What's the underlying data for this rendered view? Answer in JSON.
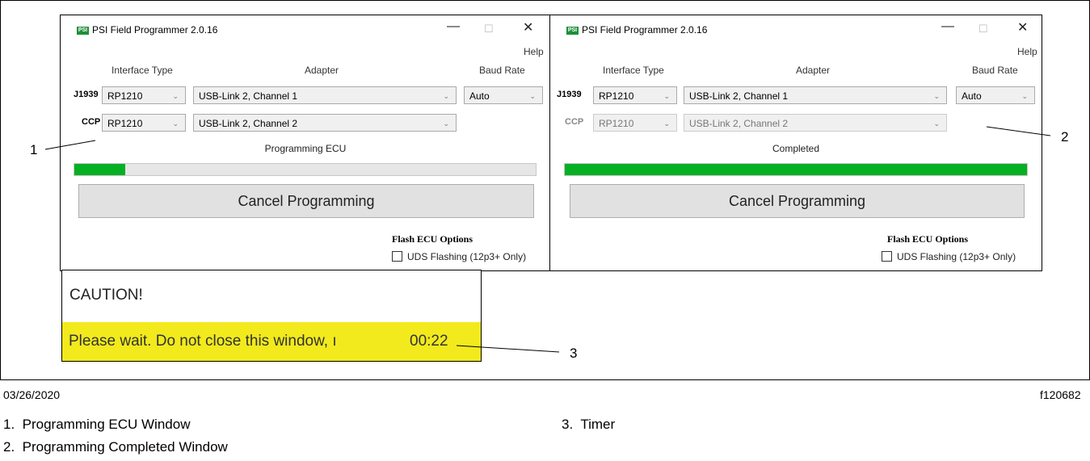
{
  "window": {
    "title": "PSI Field Programmer 2.0.16",
    "app_icon_text": "PSI",
    "minimize_glyph": "—",
    "maximize_glyph": "☐",
    "close_glyph": "✕",
    "help": "Help",
    "col_interface": "Interface Type",
    "col_adapter": "Adapter",
    "col_baud": "Baud Rate",
    "row_j1939": "J1939",
    "row_ccp": "CCP",
    "cancel_button": "Cancel Programming",
    "flash_header": "Flash ECU Options",
    "uds_checkbox": "UDS Flashing (12p3+ Only)"
  },
  "left_window": {
    "j1939_interface": "RP1210",
    "j1939_adapter": "USB-Link 2, Channel 1",
    "j1939_baud": "Auto",
    "ccp_interface": "RP1210",
    "ccp_adapter": "USB-Link 2, Channel 2",
    "status": "Programming ECU",
    "progress_fraction": 0.11
  },
  "right_window": {
    "j1939_interface": "RP1210",
    "j1939_adapter": "USB-Link 2, Channel 1",
    "j1939_baud": "Auto",
    "ccp_interface": "RP1210",
    "ccp_adapter": "USB-Link 2, Channel 2",
    "status": "Completed",
    "progress_fraction": 1.0
  },
  "caution": {
    "title": "CAUTION!",
    "message": "Please wait. Do not close this window, ı",
    "timer": "00:22",
    "band_color": "#f2ea1c"
  },
  "callouts": {
    "c1": "1",
    "c2": "2",
    "c3": "3"
  },
  "footer": {
    "date": "03/26/2020",
    "figure_id": "f120682"
  },
  "captions": [
    {
      "num": "1.",
      "text": "Programming ECU Window"
    },
    {
      "num": "2.",
      "text": "Programming Completed Window"
    },
    {
      "num": "3.",
      "text": "Timer"
    }
  ],
  "colors": {
    "progress": "#06b025"
  },
  "icons": {
    "dropdown": "chevron-down-icon",
    "app": "psi-app-icon"
  }
}
